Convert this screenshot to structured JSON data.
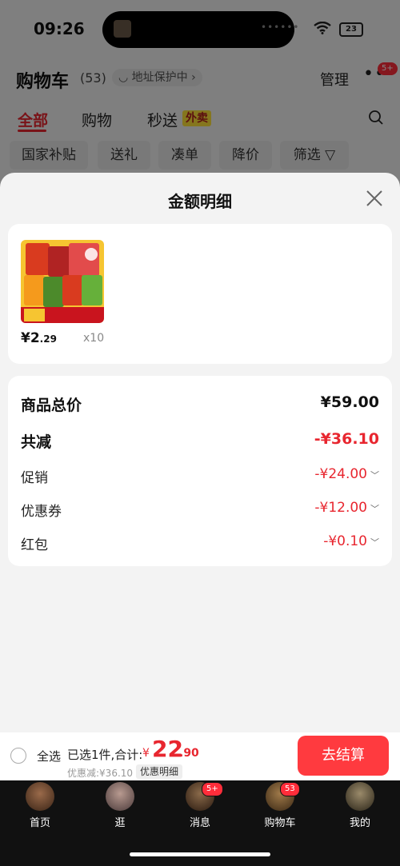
{
  "status": {
    "time": "09:26",
    "battery": "23"
  },
  "header": {
    "title": "购物车",
    "count": "(53)",
    "address_badge": "地址保护中",
    "manage": "管理",
    "more_badge": "5+"
  },
  "tabs": [
    {
      "label": "全部",
      "active": true
    },
    {
      "label": "购物",
      "active": false
    },
    {
      "label": "秒送",
      "active": false
    }
  ],
  "waimai_tag": "外卖",
  "filters": [
    "国家补贴",
    "送礼",
    "凑单",
    "降价",
    "筛选"
  ],
  "sheet": {
    "title": "金额明细",
    "product": {
      "price_int": "¥2",
      "price_dec": ".29",
      "qty": "x10"
    },
    "rows": [
      {
        "label": "商品总价",
        "value": "¥59.00"
      },
      {
        "label": "共减",
        "value": "-¥36.10"
      },
      {
        "label": "促销",
        "value": "-¥24.00"
      },
      {
        "label": "优惠券",
        "value": "-¥12.00"
      },
      {
        "label": "红包",
        "value": "-¥0.10"
      }
    ]
  },
  "bottom": {
    "select_all": "全选",
    "selected_text": "已选1件,合计:",
    "total_currency": "¥",
    "total_int": "22",
    "total_dec": ".90",
    "discount_text": "优惠减:¥36.10",
    "detail_button": "优惠明细",
    "checkout": "去结算"
  },
  "tabbar": [
    {
      "label": "首页",
      "badge": ""
    },
    {
      "label": "逛",
      "badge": ""
    },
    {
      "label": "消息",
      "badge": "5+"
    },
    {
      "label": "购物车",
      "badge": "53"
    },
    {
      "label": "我的",
      "badge": ""
    }
  ],
  "colors": {
    "accent": "#e8262f",
    "checkout": "#ff3a3f",
    "tabbar": "#111111"
  }
}
